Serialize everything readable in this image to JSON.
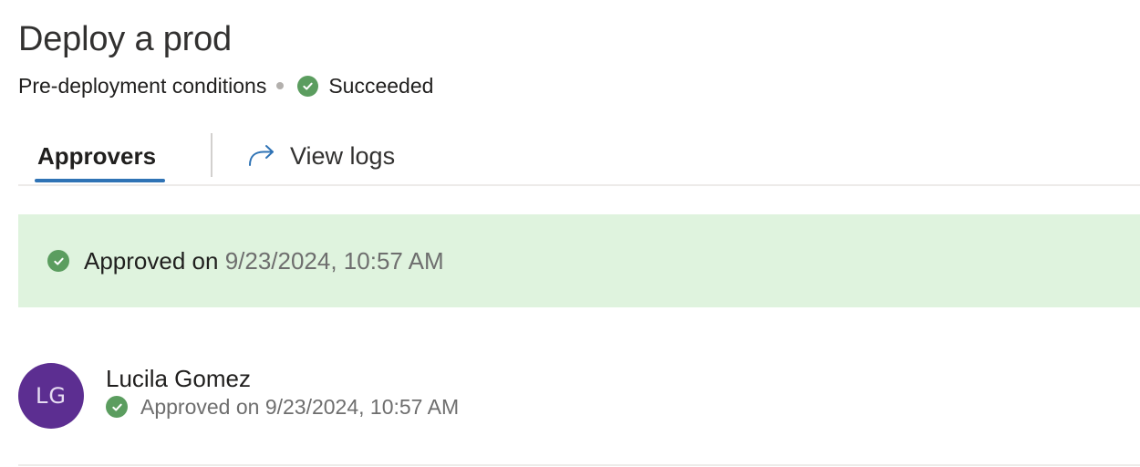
{
  "header": {
    "title": "Deploy a prod",
    "subtitle_label": "Pre-deployment conditions",
    "status_text": "Succeeded"
  },
  "tabs": [
    {
      "label": "Approvers",
      "selected": true
    },
    {
      "label": "View logs",
      "selected": false,
      "icon": "share-arrow-icon"
    }
  ],
  "banner": {
    "label": "Approved on",
    "timestamp": "9/23/2024, 10:57 AM",
    "icon": "check-circle-icon"
  },
  "approvers": [
    {
      "initials": "LG",
      "name": "Lucila Gomez",
      "status_label": "Approved on 9/23/2024, 10:57 AM",
      "icon": "check-circle-icon"
    }
  ],
  "colors": {
    "success_green": "#5b9d5f",
    "banner_bg": "#dff3de",
    "tab_accent": "#2f73b5",
    "avatar_bg": "#5c2e91"
  }
}
